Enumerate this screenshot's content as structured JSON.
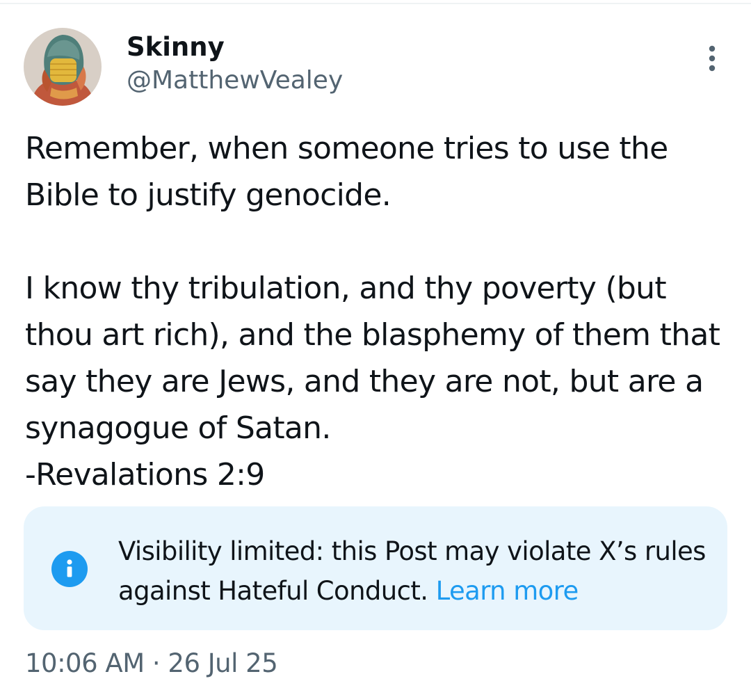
{
  "post": {
    "author": {
      "display_name": "Skinny",
      "handle": "@MatthewVealey"
    },
    "more_icon": "more-vertical-icon",
    "text": "Remember, when someone tries to use the Bible to justify genocide.\n\nI know thy tribulation, and thy poverty (but thou art rich), and the blasphemy of them that say they are Jews, and they are not, but are a synagogue of Satan.\n-Revalations 2:9",
    "notice": {
      "icon": "info-icon",
      "text": "Visibility limited: this Post may violate X’s rules against Hateful Conduct. ",
      "link": "Learn more"
    },
    "timestamp": {
      "time": "10:06 AM",
      "separator": " · ",
      "date": "26 Jul 25"
    }
  },
  "colors": {
    "accent": "#1d9bf0",
    "notice_bg": "#e8f5fd",
    "secondary_text": "#536471",
    "primary_text": "#0f1419"
  }
}
